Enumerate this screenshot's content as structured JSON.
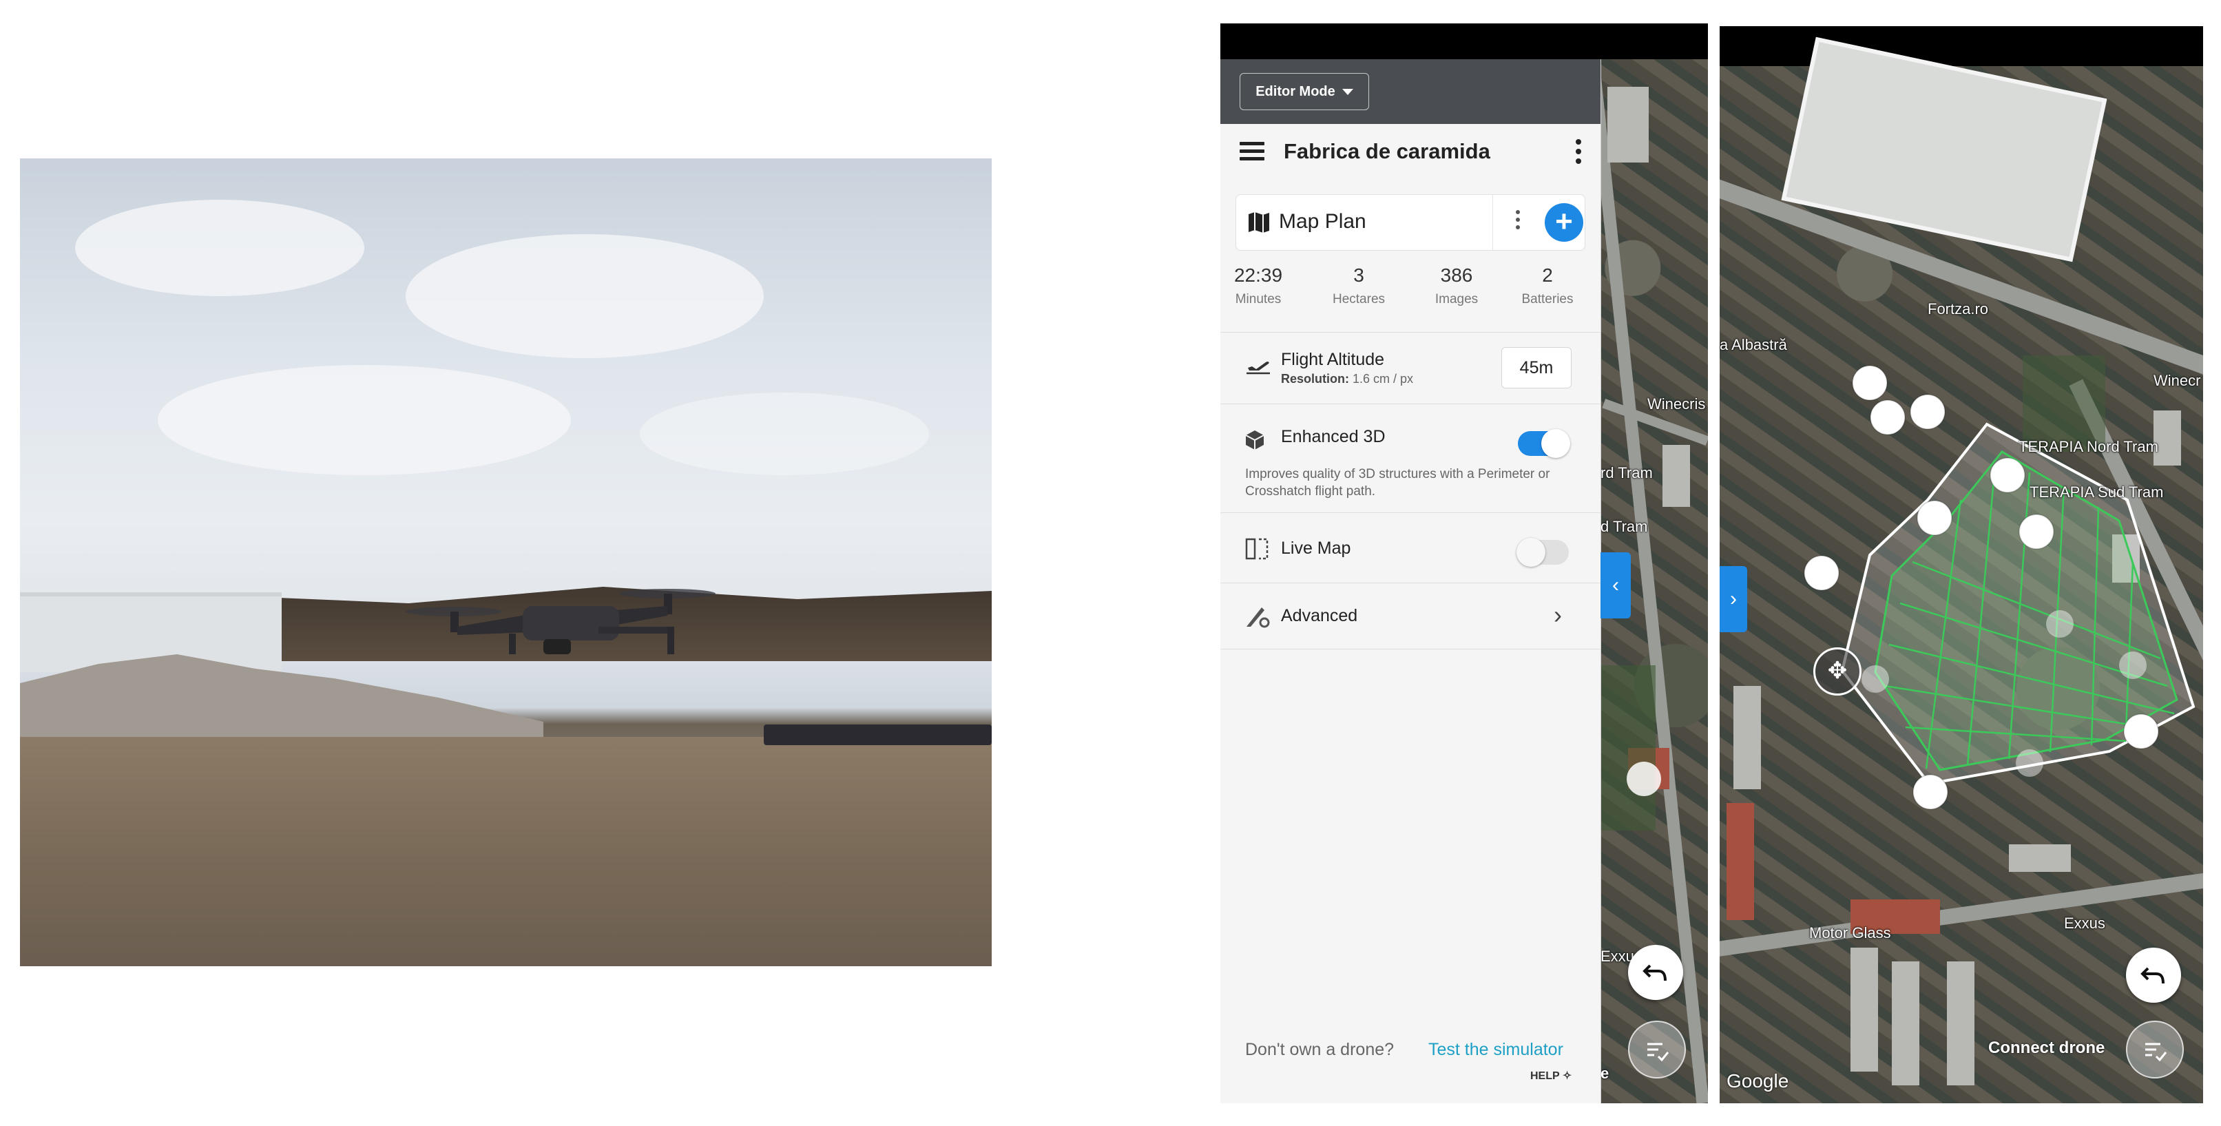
{
  "editor": {
    "mode_label": "Editor Mode"
  },
  "project": {
    "title": "Fabrica de caramida"
  },
  "plan": {
    "label": "Map Plan",
    "add_symbol": "+"
  },
  "stats": [
    {
      "value": "22:39",
      "label": "Minutes"
    },
    {
      "value": "3",
      "label": "Hectares"
    },
    {
      "value": "386",
      "label": "Images"
    },
    {
      "value": "2",
      "label": "Batteries"
    }
  ],
  "altitude": {
    "label": "Flight Altitude",
    "resolution_label": "Resolution:",
    "resolution_value": "1.6 cm / px",
    "value": "45m"
  },
  "enhanced3d": {
    "label": "Enhanced 3D",
    "enabled": true,
    "description": "Improves quality of 3D structures with a Perimeter or Crosshatch flight path."
  },
  "livemap": {
    "label": "Live Map",
    "enabled": false
  },
  "advanced": {
    "label": "Advanced"
  },
  "footer": {
    "question": "Don't own a drone?",
    "link": "Test the simulator"
  },
  "help_label": "HELP",
  "map_labels": {
    "winecris": "Winecris",
    "rd_tram": "rd Tram",
    "d_tram": "d Tram",
    "exxus1": "Exxus",
    "e_edge": "e",
    "fortza": "Fortza.ro",
    "albastra": "a Albastră",
    "winecr2": "Winecr",
    "terapia_nord": "TERAPIA Nord Tram",
    "terapia_sud": "TERAPIA Sud Tram",
    "motor_glass": "Motor Glass",
    "exxus2": "Exxus"
  },
  "connect_label": "Connect drone",
  "google_label": "Google",
  "colors": {
    "accent": "#1e88e5",
    "link": "#1ea0c6",
    "editor_bar": "#4a4e52",
    "grid": "#3cc95a"
  }
}
